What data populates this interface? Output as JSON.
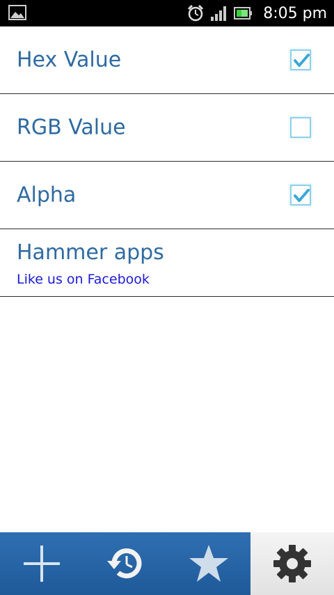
{
  "status_bar": {
    "time": "8:05 pm",
    "icons": [
      "gallery-icon",
      "alarm-icon",
      "signal-icon",
      "battery-icon"
    ]
  },
  "settings": [
    {
      "label": "Hex Value",
      "checked": true
    },
    {
      "label": "RGB Value",
      "checked": false
    },
    {
      "label": "Alpha",
      "checked": true
    }
  ],
  "promo": {
    "title": "Hammer apps",
    "link": "Like us on Facebook"
  },
  "tabs": [
    {
      "icon": "plus-icon",
      "active": false
    },
    {
      "icon": "history-icon",
      "active": false
    },
    {
      "icon": "star-icon",
      "active": false
    },
    {
      "icon": "gear-icon",
      "active": true
    }
  ],
  "colors": {
    "accent": "#2f6aa1",
    "link": "#1a1ad6",
    "tab_bar": "#2a66a8",
    "checkbox_border": "#8fd0ea",
    "check_mark": "#3aa7d6"
  }
}
